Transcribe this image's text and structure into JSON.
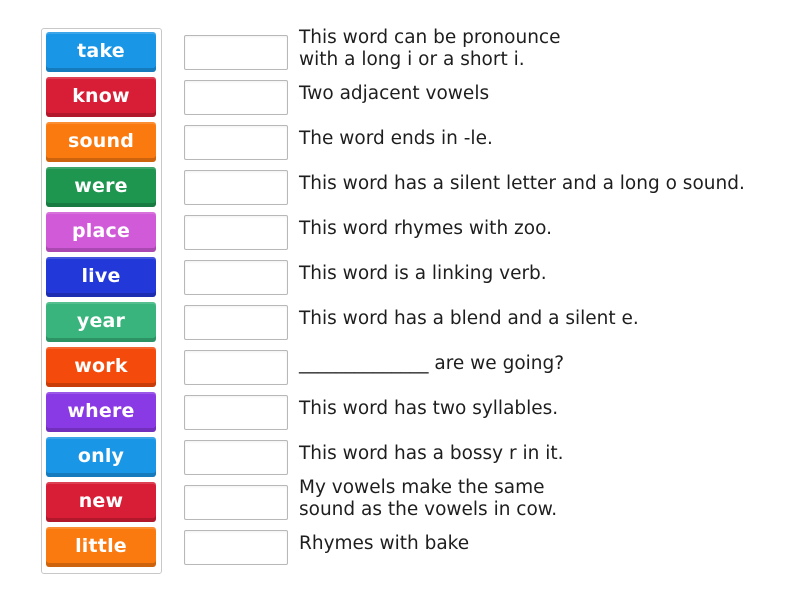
{
  "tiles": [
    {
      "label": "take",
      "color": "#1a96e6"
    },
    {
      "label": "know",
      "color": "#d81e36"
    },
    {
      "label": "sound",
      "color": "#fb7a10"
    },
    {
      "label": "were",
      "color": "#1e9650"
    },
    {
      "label": "place",
      "color": "#d05ad8"
    },
    {
      "label": "live",
      "color": "#2338d8"
    },
    {
      "label": "year",
      "color": "#38b47c"
    },
    {
      "label": "work",
      "color": "#f44a0c"
    },
    {
      "label": "where",
      "color": "#8a3ae4"
    },
    {
      "label": "only",
      "color": "#1a96e6"
    },
    {
      "label": "new",
      "color": "#d81e36"
    },
    {
      "label": "little",
      "color": "#fb7a10"
    }
  ],
  "clues": [
    "This word can be pronounce\nwith a long i or a short i.",
    "Two adjacent vowels",
    "The word ends in -le.",
    "This word has a silent letter and a long o sound.",
    "This word rhymes with zoo.",
    "This word is a linking verb.",
    "This word has a blend and a silent e.",
    "______________ are we going?",
    "This word has two syllables.",
    "This word has a bossy r in it.",
    "My vowels make the same\nsound as the vowels in cow.",
    "Rhymes with bake"
  ]
}
